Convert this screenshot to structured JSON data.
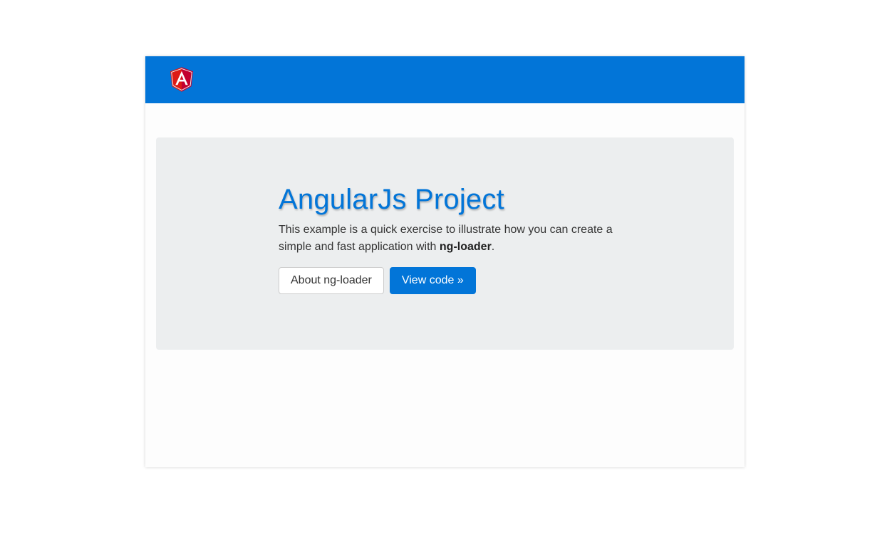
{
  "navbar": {
    "logo_icon": "angular-logo-icon",
    "logo_letter": "A",
    "background_color": "#0275d8"
  },
  "jumbotron": {
    "title": "AngularJs Project",
    "lead_text": "This example is a quick exercise to illustrate how you can create a simple and fast application with ",
    "lead_strong": "ng-loader",
    "lead_end": ".",
    "background_color": "#eceeef"
  },
  "buttons": {
    "about_label": "About ng-loader",
    "view_code_label": "View code »"
  },
  "colors": {
    "primary": "#0275d8",
    "title": "#0275d8",
    "logo_red": "#dd1b16"
  }
}
